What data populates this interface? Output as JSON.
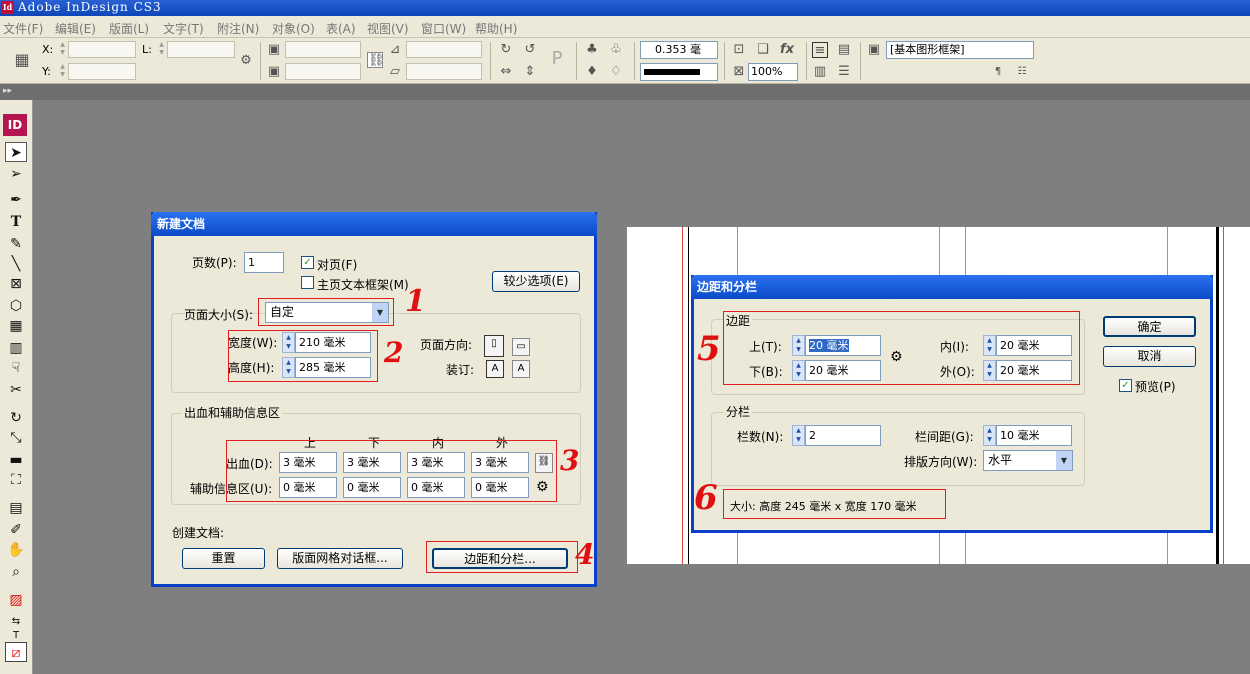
{
  "window": {
    "title": "Adobe InDesign CS3",
    "app_icon": "Id"
  },
  "menu": [
    "文件(F)",
    "编辑(E)",
    "版面(L)",
    "文字(T)",
    "附注(N)",
    "对象(O)",
    "表(A)",
    "视图(V)",
    "窗口(W)",
    "帮助(H)"
  ],
  "control": {
    "x_label": "X:",
    "y_label": "Y:",
    "l_label": "L:",
    "stroke_weight": "0.353 毫",
    "zoom": "100%",
    "object_style": "[基本图形框架]"
  },
  "toolbox": {
    "logo": "ID"
  },
  "new_doc": {
    "title": "新建文档",
    "pages_label": "页数(P):",
    "pages_value": "1",
    "facing_label": "对页(F)",
    "facing_checked": "✓",
    "master_text_label": "主页文本框架(M)",
    "fewer_options": "较少选项(E)",
    "page_size_label": "页面大小(S):",
    "page_size_value": "自定",
    "width_label": "宽度(W):",
    "width_value": "210 毫米",
    "height_label": "高度(H):",
    "height_value": "285 毫米",
    "orientation_label": "页面方向:",
    "binding_label": "装订:",
    "bleed_group": "出血和辅助信息区",
    "col_top": "上",
    "col_bottom": "下",
    "col_inside": "内",
    "col_outside": "外",
    "bleed_label": "出血(D):",
    "bleed_values": [
      "3 毫米",
      "3 毫米",
      "3 毫米",
      "3 毫米"
    ],
    "slug_label": "辅助信息区(U):",
    "slug_values": [
      "0 毫米",
      "0 毫米",
      "0 毫米",
      "0 毫米"
    ],
    "create_label": "创建文档:",
    "reset_btn": "重置",
    "grid_btn": "版面网格对话框...",
    "margins_btn": "边距和分栏..."
  },
  "margins_dialog": {
    "title": "边距和分栏",
    "margin_group": "边距",
    "top_label": "上(T):",
    "top_value": "20 毫米",
    "bottom_label": "下(B):",
    "bottom_value": "20 毫米",
    "inside_label": "内(I):",
    "inside_value": "20 毫米",
    "outside_label": "外(O):",
    "outside_value": "20 毫米",
    "columns_group": "分栏",
    "cols_label": "栏数(N):",
    "cols_value": "2",
    "gutter_label": "栏间距(G):",
    "gutter_value": "10 毫米",
    "direction_label": "排版方向(W):",
    "direction_value": "水平",
    "size_text": "大小: 高度 245 毫米 x 宽度 170 毫米",
    "ok_btn": "确定",
    "cancel_btn": "取消",
    "preview_label": "预览(P)",
    "preview_checked": "✓"
  },
  "annotations": [
    "1",
    "2",
    "3",
    "4",
    "5",
    "6"
  ],
  "colors": {
    "title_blue": "#0b4ac8",
    "dialog_bg": "#ece9d8",
    "annotation_red": "#e01010",
    "canvas_gray": "#7f7f7f"
  }
}
